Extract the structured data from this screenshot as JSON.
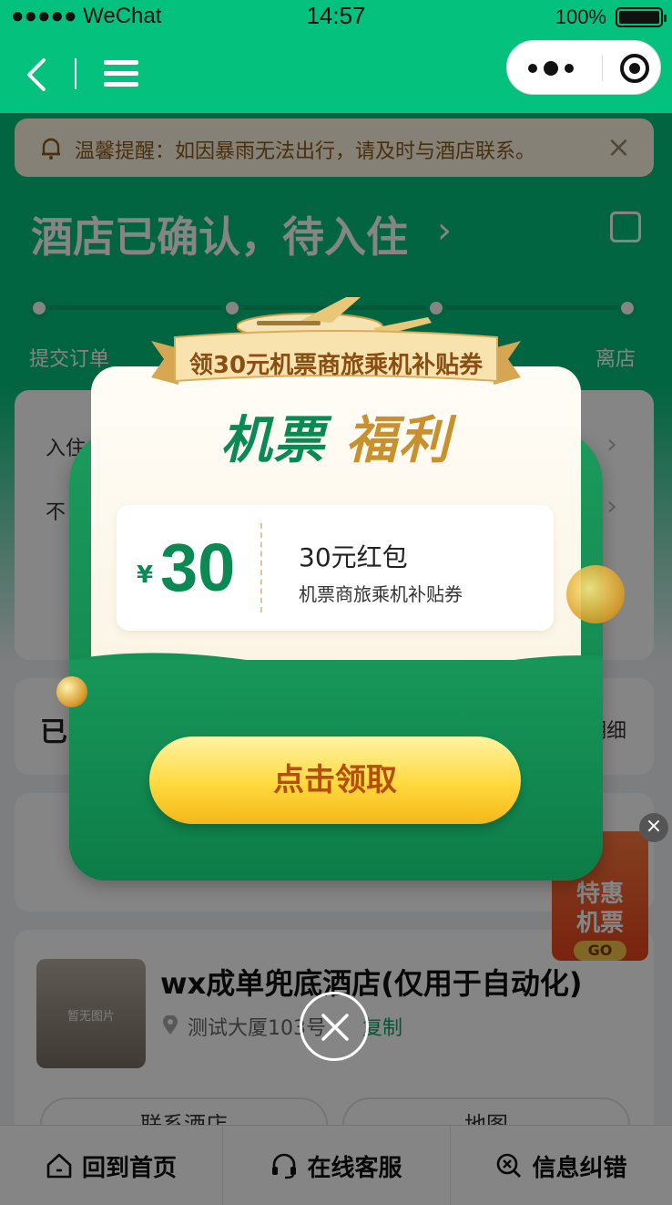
{
  "status_bar": {
    "carrier": "●●●●● WeChat",
    "time": "14:57",
    "battery": "100%"
  },
  "notice": {
    "text": "温馨提醒：如因暴雨无法出行，请及时与酒店联系。"
  },
  "order_status": {
    "title": "酒店已确认，待入住"
  },
  "progress": {
    "steps": [
      "提交订单",
      "离店"
    ]
  },
  "card1": {
    "row1": "入住",
    "row2": "不"
  },
  "card2": {
    "title": "已",
    "link": "明细"
  },
  "hotel": {
    "name": "wx成单兜底酒店(仅用于自动化)",
    "address": "测试大厦103号",
    "copy": "复制",
    "thumb_placeholder": "暂无图片",
    "contact_button": "联系酒店",
    "map_button": "地图"
  },
  "float_ad": {
    "line1": "特惠",
    "line2": "机票",
    "go": "GO"
  },
  "popup": {
    "ribbon": "领30元机票商旅乘机补贴券",
    "headline_a": "机票",
    "headline_b": "福利",
    "coupon": {
      "currency": "¥",
      "amount": "30",
      "title": "30元红包",
      "desc": "机票商旅乘机补贴券"
    },
    "claim_button": "点击领取"
  },
  "tabbar": {
    "home": "回到首页",
    "service": "在线客服",
    "report": "信息纠错"
  },
  "colors": {
    "brand_green": "#05c17e",
    "popup_green": "#0f7f4a",
    "gold": "#c8912e",
    "button_yellow": "#ffd93d",
    "button_text": "#b64d08"
  }
}
